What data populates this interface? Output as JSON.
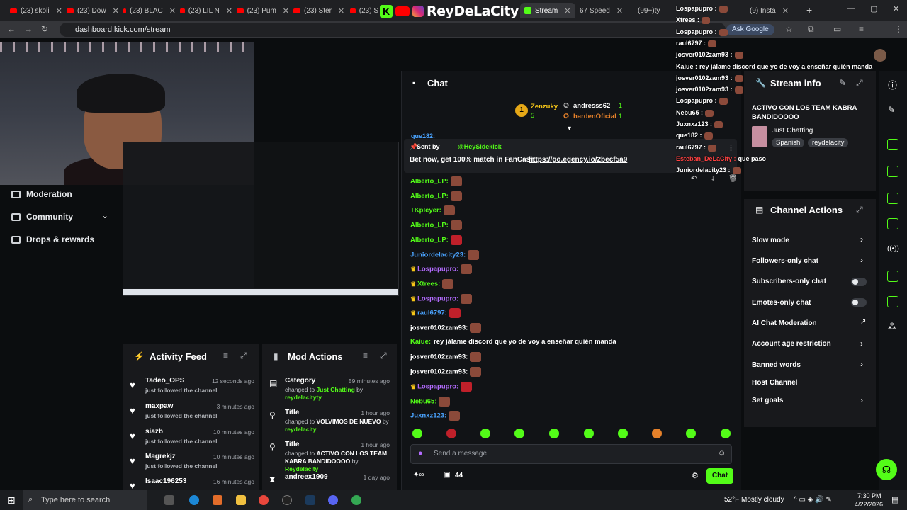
{
  "browser": {
    "tabs": [
      {
        "label": "(23) skoli",
        "kind": "yt"
      },
      {
        "label": "(23) Dow",
        "kind": "yt"
      },
      {
        "label": "(23) BLAC",
        "kind": "yt"
      },
      {
        "label": "(23) LIL N",
        "kind": "yt"
      },
      {
        "label": "(23) Pum",
        "kind": "yt"
      },
      {
        "label": "(23) Ster",
        "kind": "yt"
      },
      {
        "label": "(23) S",
        "kind": "yt"
      },
      {
        "label": "Stream",
        "kind": "kick",
        "active": true
      },
      {
        "label": "67 Speed",
        "kind": "other"
      },
      {
        "label": "(99+)ty",
        "kind": "other"
      },
      {
        "label": "(9) Insta",
        "kind": "other"
      }
    ],
    "url": "dashboard.kick.com/stream",
    "ask_google": "Ask Google",
    "overlay_brand": "ReyDeLaCity"
  },
  "left_nav": {
    "moderation": "Moderation",
    "community": "Community",
    "drops": "Drops & rewards"
  },
  "activity_feed": {
    "title": "Activity Feed",
    "items": [
      {
        "name": "Tadeo_OPS",
        "time": "12 seconds ago",
        "text": "just followed the channel"
      },
      {
        "name": "maxpaw",
        "time": "3 minutes ago",
        "text": "just followed the channel"
      },
      {
        "name": "siazb",
        "time": "10 minutes ago",
        "text": "just followed the channel"
      },
      {
        "name": "Magrekjz",
        "time": "10 minutes ago",
        "text": "just followed the channel"
      },
      {
        "name": "Isaac196253",
        "time": "16 minutes ago",
        "text": ""
      }
    ]
  },
  "mod_actions": {
    "title": "Mod Actions",
    "items": [
      {
        "name": "Category",
        "time": "59 minutes ago",
        "pre": "changed to",
        "value": "Just Chatting",
        "by": "by",
        "user": "reydelacityty"
      },
      {
        "name": "Title",
        "time": "1 hour ago",
        "pre": "changed to",
        "value": "VOLVIMOS DE NUEVO",
        "by": "by",
        "user": "reydelacity"
      },
      {
        "name": "Title",
        "time": "1 hour ago",
        "pre": "changed to",
        "value": "ACTIVO CON LOS TEAM KABRA BANDIDOOOO",
        "by": "by",
        "user": "Reydelacity"
      },
      {
        "name": "andreex1909",
        "time": "1 day ago",
        "pre": "",
        "value": "",
        "by": "",
        "user": ""
      }
    ]
  },
  "chat": {
    "title": "Chat",
    "leaderboard": {
      "top": {
        "rank": "1",
        "name": "Zenzuky",
        "count": "5"
      },
      "others": [
        {
          "name": "andresss62",
          "count": "1"
        },
        {
          "name": "hardenOficial",
          "count": "1"
        }
      ]
    },
    "pinned": {
      "sent_by_label": "Sent by",
      "sender": "@HeySidekick",
      "message": "Bet now, get 100% match in FanCash",
      "link": "https://go.egency.io/2becf5a9"
    },
    "messages": [
      {
        "user": "Alberto_LP:",
        "color": "#53fc18",
        "text": "",
        "crown": false
      },
      {
        "user": "Alberto_LP:",
        "color": "#53fc18",
        "text": "",
        "crown": false
      },
      {
        "user": "TKpleyer:",
        "color": "#53fc18",
        "text": "",
        "crown": false
      },
      {
        "user": "Alberto_LP:",
        "color": "#53fc18",
        "text": "",
        "crown": false
      },
      {
        "user": "Alberto_LP:",
        "color": "#53fc18",
        "text": "",
        "crown": false
      },
      {
        "user": "Juniordelacity23:",
        "color": "#4aa3ff",
        "text": "",
        "crown": false
      },
      {
        "user": "Lospapupro:",
        "color": "#b36bff",
        "text": "",
        "crown": true
      },
      {
        "user": "Xtrees:",
        "color": "#53fc18",
        "text": "",
        "crown": true
      },
      {
        "user": "Lospapupro:",
        "color": "#b36bff",
        "text": "",
        "crown": true
      },
      {
        "user": "raul6797:",
        "color": "#4aa3ff",
        "text": "",
        "crown": true
      },
      {
        "user": "josver0102zam93:",
        "color": "#ffffff",
        "text": "",
        "crown": false
      },
      {
        "user": "Kaiue:",
        "color": "#53fc18",
        "text": "rey jálame discord que yo de voy a enseñar quién manda",
        "crown": false
      },
      {
        "user": "josver0102zam93:",
        "color": "#ffffff",
        "text": "",
        "crown": false
      },
      {
        "user": "josver0102zam93:",
        "color": "#ffffff",
        "text": "",
        "crown": false
      },
      {
        "user": "Lospapupro:",
        "color": "#b36bff",
        "text": "",
        "crown": true
      },
      {
        "user": "Nebu65:",
        "color": "#53fc18",
        "text": "",
        "crown": false
      },
      {
        "user": "Juxnxz123:",
        "color": "#4aa3ff",
        "text": "",
        "crown": false
      }
    ],
    "input_placeholder": "Send a message",
    "points": "44",
    "send_label": "Chat",
    "partial_top_user": "que182:"
  },
  "stream_info": {
    "title": "Stream info",
    "stream_title": "ACTIVO CON LOS TEAM KABRA BANDIDOOOO",
    "category": "Just Chatting",
    "tags": [
      "Spanish",
      "reydelacity"
    ]
  },
  "channel_actions": {
    "title": "Channel Actions",
    "items": [
      {
        "label": "Slow mode",
        "control": "chevron"
      },
      {
        "label": "Followers-only chat",
        "control": "chevron"
      },
      {
        "label": "Subscribers-only chat",
        "control": "toggle"
      },
      {
        "label": "Emotes-only chat",
        "control": "toggle"
      },
      {
        "label": "AI Chat Moderation",
        "control": "external"
      },
      {
        "label": "Account age restriction",
        "control": "chevron"
      },
      {
        "label": "Banned words",
        "control": "chevron"
      },
      {
        "label": "Host Channel",
        "control": "none"
      },
      {
        "label": "Set goals",
        "control": "chevron"
      }
    ]
  },
  "overlay_chat": [
    {
      "user": "Lospapupro :",
      "text": ""
    },
    {
      "user": "Xtrees :",
      "text": ""
    },
    {
      "user": "Lospapupro :",
      "text": ""
    },
    {
      "user": "raul6797 :",
      "text": ""
    },
    {
      "user": "josver0102zam93 :",
      "text": ""
    },
    {
      "user": "Kaiue :",
      "text": "rey jálame discord que yo de voy a enseñar quién manda"
    },
    {
      "user": "josver0102zam93 :",
      "text": ""
    },
    {
      "user": "josver0102zam93 :",
      "text": ""
    },
    {
      "user": "Lospapupro :",
      "text": ""
    },
    {
      "user": "Nebu65 :",
      "text": ""
    },
    {
      "user": "Juxnxz123 :",
      "text": ""
    },
    {
      "user": "que182 :",
      "text": ""
    },
    {
      "user": "raul6797 :",
      "text": ""
    },
    {
      "user": "Esteban_DeLaCity :",
      "text": "que paso"
    },
    {
      "user": "Juniordelacity23 :",
      "text": ""
    }
  ],
  "taskbar": {
    "search_placeholder": "Type here to search",
    "weather": "52°F  Mostly cloudy",
    "time": "7:30 PM",
    "date": "4/22/2026"
  },
  "colors": {
    "accent": "#53fc18",
    "panel": "#18191c",
    "bg": "#0b0d0f"
  }
}
